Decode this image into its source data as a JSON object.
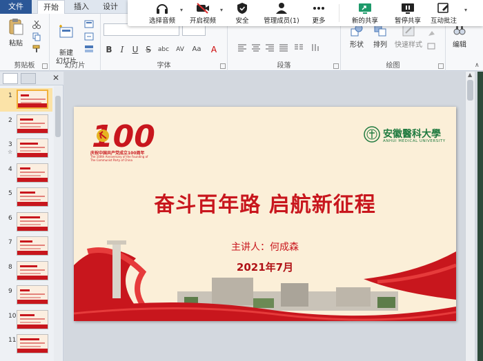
{
  "tabs": {
    "file": "文件",
    "home": "开始",
    "insert": "插入",
    "design": "设计"
  },
  "ribbon": {
    "clipboard": {
      "label": "剪贴板",
      "paste": "粘贴"
    },
    "slides": {
      "label": "幻灯片",
      "new_slide": "新建\n幻灯片"
    },
    "font": {
      "label": "字体"
    },
    "paragraph": {
      "label": "段落"
    },
    "drawing": {
      "label": "绘图",
      "shape": "形状",
      "arrange": "排列",
      "quick_style": "快速样式"
    },
    "editing": {
      "label": "编辑"
    },
    "format_buttons": [
      "B",
      "I",
      "U",
      "S",
      "abc",
      "AV",
      "Aa",
      "A"
    ]
  },
  "meeting_bar": {
    "select_audio": "选择音频",
    "start_video": "开启视频",
    "security": "安全",
    "manage_members": "管理成员(1)",
    "more": "更多",
    "new_share": "新的共享",
    "pause_share": "暂停共享",
    "annotate": "互动批注"
  },
  "slides_panel": {
    "numbers": [
      "1",
      "2",
      "3",
      "4",
      "5",
      "6",
      "7",
      "8",
      "9",
      "10",
      "11"
    ],
    "selected_index": 0,
    "star_slide": 2
  },
  "slide": {
    "badge_text": "100",
    "badge_caption": "庆祝中国共产党成立100周年",
    "badge_caption_en": "The 100th Anniversary of the Founding of The Communist Party of China",
    "university_name": "安徽醫科大學",
    "university_en": "ANHUI MEDICAL UNIVERSITY",
    "title": "奋斗百年路   启航新征程",
    "speaker": "主讲人：何成森",
    "date": "2021年7月"
  },
  "colors": {
    "accent_red": "#c8161d",
    "university_green": "#1f7a3f",
    "file_tab": "#2b5797",
    "meeting_active_green": "#1e9a6a"
  }
}
